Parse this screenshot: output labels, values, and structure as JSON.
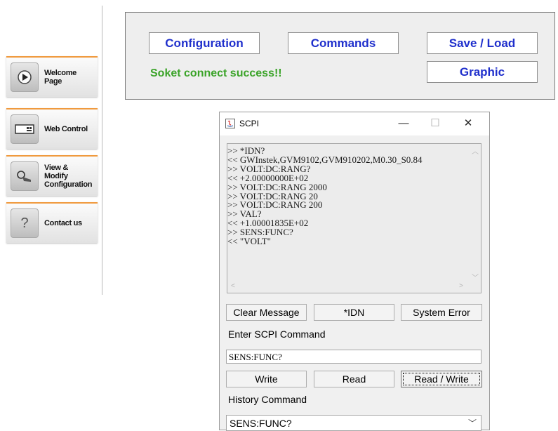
{
  "nav": {
    "items": [
      {
        "label": "Welcome Page",
        "icon": "play-icon"
      },
      {
        "label": "Web Control",
        "icon": "keyboard-icon"
      },
      {
        "label": "View & Modify Configuration",
        "icon": "hand-icon"
      },
      {
        "label": "Contact us",
        "icon": "question-icon"
      }
    ]
  },
  "top": {
    "configuration": "Configuration",
    "commands": "Commands",
    "save_load": "Save / Load",
    "graphic": "Graphic",
    "status": "Soket connect success!!"
  },
  "window": {
    "title": "SCPI",
    "minimize": "—",
    "maximize": "☐",
    "close": "✕",
    "console": ">> *IDN?\n<< GWInstek,GVM9102,GVM910202,M0.30_S0.84\n>> VOLT:DC:RANG?\n<< +2.00000000E+02\n>> VOLT:DC:RANG 2000\n>> VOLT:DC:RANG 20\n>> VOLT:DC:RANG 200\n>> VAL?\n<< +1.00001835E+02\n>> SENS:FUNC?\n<< \"VOLT\"",
    "clear_message": "Clear Message",
    "idn": "*IDN",
    "system_error": "System Error",
    "enter_label": "Enter SCPI Command",
    "command_value": "SENS:FUNC?",
    "write": "Write",
    "read": "Read",
    "read_write": "Read / Write",
    "history_label": "History Command",
    "history_value": "SENS:FUNC?"
  },
  "colors": {
    "nav_accent": "#f09a3e",
    "button_text": "#1f2fcc",
    "status_text": "#3aa328"
  }
}
